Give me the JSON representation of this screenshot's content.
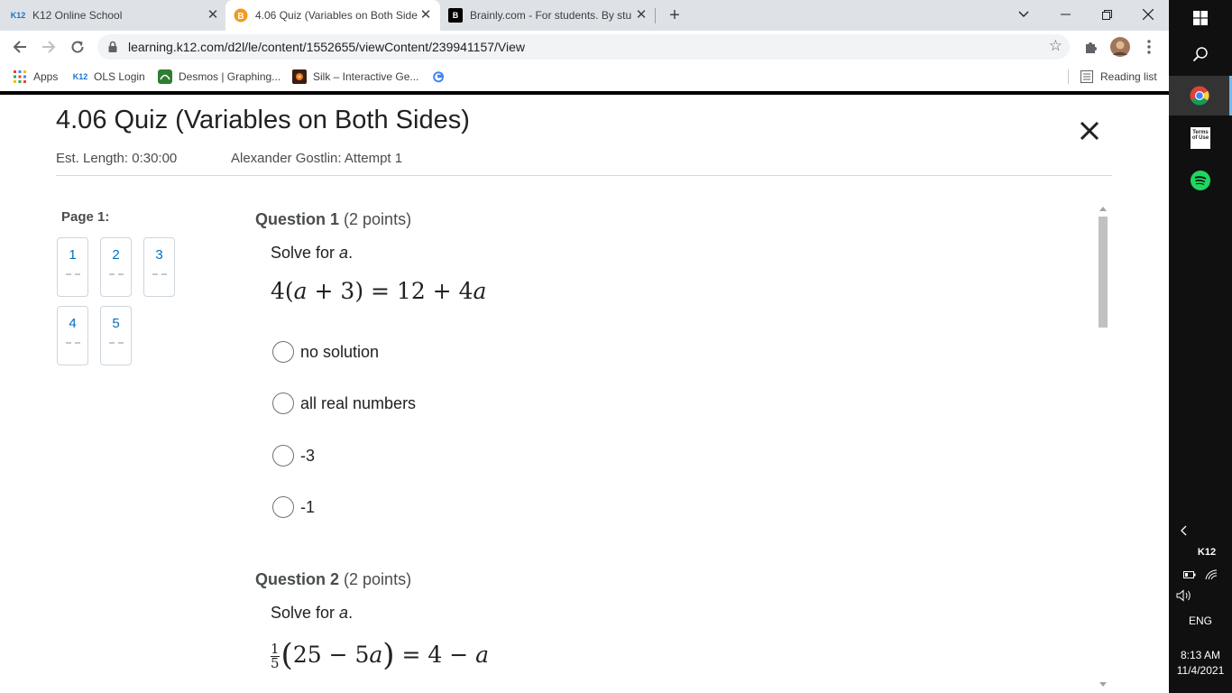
{
  "browser": {
    "tabs": [
      {
        "favicon": "K12",
        "title": "K12 Online School",
        "active": false
      },
      {
        "favicon": "quiz-favicon",
        "title": "4.06 Quiz (Variables on Both Side",
        "active": true
      },
      {
        "favicon": "B",
        "title": "Brainly.com - For students. By stu",
        "active": false
      }
    ],
    "url": "learning.k12.com/d2l/le/content/1552655/viewContent/239941157/View",
    "bookmarks": [
      {
        "icon": "apps-grid-icon",
        "label": "Apps"
      },
      {
        "icon": "K12",
        "label": "OLS Login"
      },
      {
        "icon": "desmos-icon",
        "label": "Desmos | Graphing..."
      },
      {
        "icon": "silk-icon",
        "label": "Silk – Interactive Ge..."
      },
      {
        "icon": "google-icon",
        "label": ""
      }
    ],
    "reading_list": "Reading list"
  },
  "quiz": {
    "title": "4.06 Quiz (Variables on Both Sides)",
    "est_length": "Est. Length: 0:30:00",
    "attempt": "Alexander Gostlin: Attempt 1",
    "page_label": "Page 1:",
    "question_nav": [
      {
        "num": "1",
        "status": "--"
      },
      {
        "num": "2",
        "status": "--"
      },
      {
        "num": "3",
        "status": "--"
      },
      {
        "num": "4",
        "status": "--"
      },
      {
        "num": "5",
        "status": "--"
      }
    ],
    "questions": [
      {
        "label": "Question 1",
        "points": "(2 points)",
        "prompt_text": "Solve for ",
        "prompt_var": "a",
        "prompt_end": ".",
        "options": [
          "no solution",
          "all real numbers",
          "-3",
          "-1"
        ]
      },
      {
        "label": "Question 2",
        "points": "(2 points)",
        "prompt_text": "Solve for ",
        "prompt_var": "a",
        "prompt_end": "."
      }
    ]
  },
  "system": {
    "keyboard_lang": "ENG",
    "time": "8:13 AM",
    "date": "11/4/2021",
    "k12_tray": "K12",
    "terms_icon_text": "Terms of Use"
  }
}
